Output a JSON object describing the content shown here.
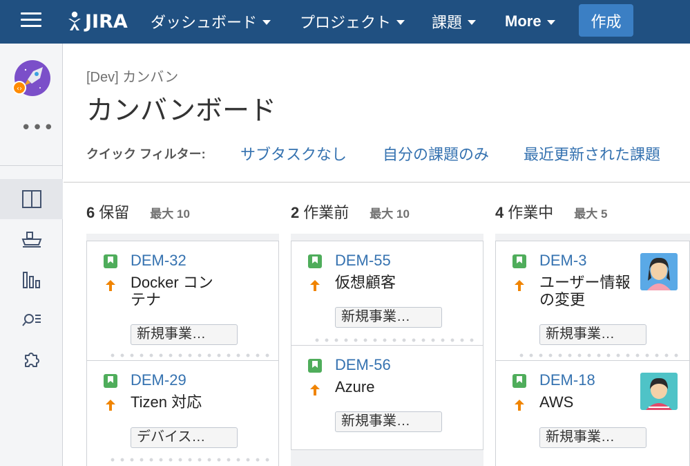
{
  "nav": {
    "logo_text": "JIRA",
    "items": [
      {
        "label": "ダッシュボード"
      },
      {
        "label": "プロジェクト"
      },
      {
        "label": "課題"
      },
      {
        "label": "More"
      }
    ],
    "create_label": "作成",
    "colors": {
      "bar": "#205081",
      "create": "#3b7fc4"
    }
  },
  "sidebar": {
    "more_label": "•••",
    "items": [
      {
        "icon": "board-icon",
        "active": true
      },
      {
        "icon": "ship-icon",
        "active": false
      },
      {
        "icon": "reports-icon",
        "active": false
      },
      {
        "icon": "issues-search-icon",
        "active": false
      },
      {
        "icon": "addon-puzzle-icon",
        "active": false
      }
    ]
  },
  "header": {
    "breadcrumb": "[Dev] カンバン",
    "title": "カンバンボード",
    "quick_filter_label": "クイック フィルター:",
    "quick_filters": [
      "サブタスクなし",
      "自分の課題のみ",
      "最近更新された課題"
    ]
  },
  "columns": [
    {
      "count": "6",
      "name": "保留",
      "max": "最大 10",
      "cards": [
        {
          "key": "DEM-32",
          "summary": "Docker コン\nテナ",
          "epic": "新規事業…",
          "priority": "high-arrow-icon",
          "has_avatar": false
        },
        {
          "key": "DEM-29",
          "summary": "Tizen 対応",
          "epic": "デバイス…",
          "priority": "high-arrow-icon",
          "has_avatar": false
        }
      ]
    },
    {
      "count": "2",
      "name": "作業前",
      "max": "最大 10",
      "cards": [
        {
          "key": "DEM-55",
          "summary": "仮想顧客",
          "epic": "新規事業…",
          "priority": "high-arrow-icon",
          "has_avatar": false
        },
        {
          "key": "DEM-56",
          "summary": "Azure",
          "epic": "新規事業…",
          "priority": "high-arrow-icon",
          "has_avatar": false
        }
      ]
    },
    {
      "count": "4",
      "name": "作業中",
      "max": "最大 5",
      "cards": [
        {
          "key": "DEM-3",
          "summary": "ユーザー情報\nの変更",
          "epic": "新規事業…",
          "priority": "high-arrow-icon",
          "has_avatar": true
        },
        {
          "key": "DEM-18",
          "summary": "AWS",
          "epic": "新規事業…",
          "priority": "high-arrow-icon",
          "has_avatar": true
        }
      ]
    }
  ]
}
